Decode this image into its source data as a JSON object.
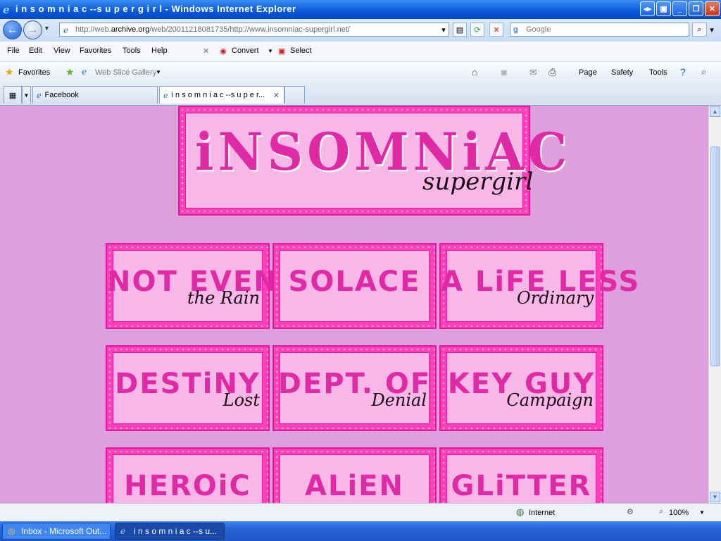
{
  "window": {
    "title": "i n s o m n i a c --s u p e r g i r l - Windows Internet Explorer"
  },
  "address": {
    "url_prefix": "http://web.",
    "url_host": "archive.org",
    "url_rest": "/web/20011218081735/http://www.insomniac-supergirl.net/"
  },
  "search": {
    "placeholder": "Google"
  },
  "menu": {
    "file": "File",
    "edit": "Edit",
    "view": "View",
    "favorites": "Favorites",
    "tools": "Tools",
    "help": "Help",
    "convert": "Convert",
    "select": "Select"
  },
  "favbar": {
    "favorites": "Favorites",
    "web_slice": "Web Slice Gallery",
    "page": "Page",
    "safety": "Safety",
    "tools": "Tools"
  },
  "tabs": [
    {
      "label": "Facebook"
    },
    {
      "label": "i n s o m n i a c --s u p e r..."
    }
  ],
  "banner": {
    "title": "iNSOMNiAC",
    "subtitle": "supergirl"
  },
  "nav": [
    {
      "main": "NOT EVEN",
      "sub": "the Rain"
    },
    {
      "main": "SOLACE",
      "sub": ""
    },
    {
      "main": "A LiFE LESS",
      "sub": "Ordinary"
    },
    {
      "main": "DESTiNY",
      "sub": "Lost"
    },
    {
      "main": "DEPT. OF",
      "sub": "Denial"
    },
    {
      "main": "KEY GUY",
      "sub": "Campaign"
    },
    {
      "main": "HEROiC",
      "sub": ""
    },
    {
      "main": "ALiEN",
      "sub": ""
    },
    {
      "main": "GLiTTER",
      "sub": ""
    }
  ],
  "status": {
    "zone": "Internet",
    "zoom": "100%"
  },
  "taskbar": [
    {
      "label": "Inbox - Microsoft Out..."
    },
    {
      "label": "i n s o m n i a c --s u..."
    }
  ]
}
